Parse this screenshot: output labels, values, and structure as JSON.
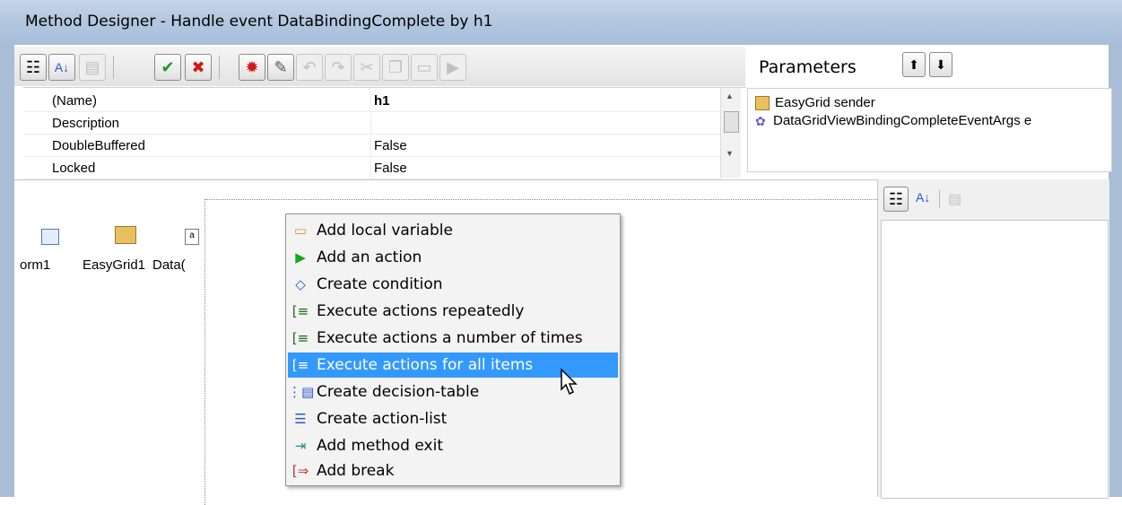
{
  "window": {
    "title": "Method Designer - Handle event DataBindingComplete by h1"
  },
  "toolbar": {
    "buttons": [
      {
        "name": "categorized-view-icon",
        "glyph": "☷",
        "enabled": true
      },
      {
        "name": "sort-alpha-icon",
        "glyph": "↓",
        "enabled": true
      },
      {
        "name": "property-pages-icon",
        "glyph": "▤",
        "enabled": false
      },
      {
        "name": "ok-check-icon",
        "glyph": "✔",
        "enabled": true
      },
      {
        "name": "cancel-x-icon",
        "glyph": "✖",
        "enabled": true
      },
      {
        "name": "debug-icon",
        "glyph": "✹",
        "enabled": true
      },
      {
        "name": "tools-icon",
        "glyph": "✎",
        "enabled": true
      },
      {
        "name": "undo-icon",
        "glyph": "↶",
        "enabled": false
      },
      {
        "name": "redo-icon",
        "glyph": "↷",
        "enabled": false
      },
      {
        "name": "cut-icon",
        "glyph": "✂",
        "enabled": false
      },
      {
        "name": "copy-icon",
        "glyph": "❐",
        "enabled": false
      },
      {
        "name": "paste-icon",
        "glyph": "▭",
        "enabled": false
      },
      {
        "name": "run-icon",
        "glyph": "▶",
        "enabled": false
      }
    ]
  },
  "properties": {
    "rows": [
      {
        "name": "(Name)",
        "value": "h1"
      },
      {
        "name": "Description",
        "value": ""
      },
      {
        "name": "DoubleBuffered",
        "value": "False"
      },
      {
        "name": "Locked",
        "value": "False"
      }
    ]
  },
  "parameters": {
    "title": "Parameters",
    "items": [
      {
        "label": "EasyGrid sender",
        "icon": "class-icon"
      },
      {
        "label": "DataGridViewBindingCompleteEventArgs e",
        "icon": "gear-icon"
      }
    ]
  },
  "components": [
    {
      "label": "orm1",
      "icon": "form-icon"
    },
    {
      "label": "EasyGrid1",
      "icon": "grid-icon"
    },
    {
      "label": "Data(",
      "icon": "textbox-icon"
    }
  ],
  "context_menu": {
    "items": [
      {
        "label": "Add local variable",
        "icon": "variable-icon",
        "glyph": "▭",
        "color": "#c89a2a",
        "selected": false
      },
      {
        "label": "Add an action",
        "icon": "action-arrow-icon",
        "glyph": "▶",
        "color": "#17a617",
        "selected": false
      },
      {
        "label": "Create condition",
        "icon": "condition-diamond-icon",
        "glyph": "◇",
        "color": "#2a55d0",
        "selected": false
      },
      {
        "label": "Execute actions repeatedly",
        "icon": "loop-icon",
        "glyph": "[≡",
        "color": "#1e6b1e",
        "selected": false
      },
      {
        "label": "Execute actions a number of times",
        "icon": "loop-count-icon",
        "glyph": "[≡",
        "color": "#1e6b1e",
        "selected": false
      },
      {
        "label": "Execute actions for all items",
        "icon": "foreach-icon",
        "glyph": "[≡",
        "color": "#ffffff",
        "selected": true
      },
      {
        "label": "Create decision-table",
        "icon": "decision-table-icon",
        "glyph": "⋮▤",
        "color": "#2a55d0",
        "selected": false
      },
      {
        "label": "Create action-list",
        "icon": "action-list-icon",
        "glyph": "☰",
        "color": "#2a55d0",
        "selected": false
      },
      {
        "label": "Add method exit",
        "icon": "method-exit-icon",
        "glyph": "⇥",
        "color": "#1e8f8f",
        "selected": false
      },
      {
        "label": "Add break",
        "icon": "break-icon",
        "glyph": "[⇒",
        "color": "#c0392b",
        "selected": false
      }
    ]
  }
}
